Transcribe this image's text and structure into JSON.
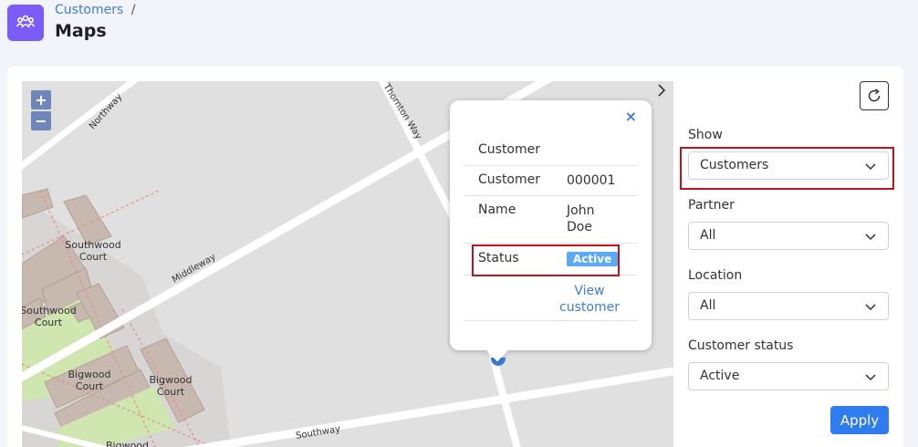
{
  "header": {
    "breadcrumb_link": "Customers",
    "breadcrumb_sep": "/",
    "title": "Maps"
  },
  "map": {
    "zoom_in": "+",
    "zoom_out": "−",
    "labels": {
      "northway": "Northway",
      "thornton_way": "Thornton Way",
      "middleway": "Middleway",
      "southway": "Southway",
      "southwood_court_1": "Southwood Court",
      "southwood_court_2": "Southwood Court",
      "bigwood_court_1": "Bigwood Court",
      "bigwood_court_2": "Bigwood Court",
      "bigwood_partial": "Bigwood"
    }
  },
  "popup": {
    "close": "×",
    "title_label": "Customer",
    "customer_label": "Customer",
    "customer_value": "000001",
    "name_label": "Name",
    "name_value_1": "John",
    "name_value_2": "Doe",
    "status_label": "Status",
    "status_value": "Active",
    "view_link_1": "View",
    "view_link_2": "customer"
  },
  "filters": {
    "show_label": "Show",
    "show_value": "Customers",
    "partner_label": "Partner",
    "partner_value": "All",
    "location_label": "Location",
    "location_value": "All",
    "status_label": "Customer status",
    "status_value": "Active",
    "apply": "Apply"
  },
  "icons": {
    "app": "customers-group-icon",
    "refresh": "refresh-icon",
    "collapse": "chevron-right-icon",
    "select": "chevron-down-icon"
  },
  "colors": {
    "accent": "#2f7bf0",
    "brand": "#7c5cf6",
    "highlight": "#c0141c",
    "badge": "#5aaaf5"
  }
}
